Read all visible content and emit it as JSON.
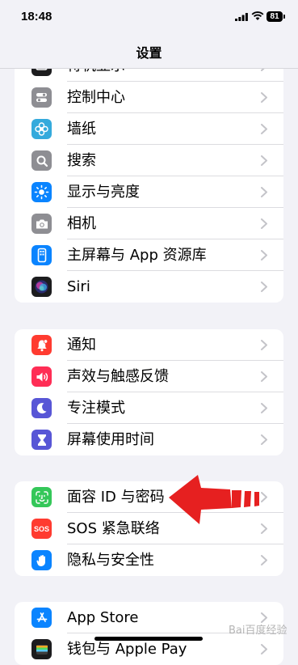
{
  "status_bar": {
    "time": "18:48",
    "battery": "81"
  },
  "nav": {
    "title": "设置"
  },
  "groups": [
    {
      "items": [
        {
          "label": "待机显示",
          "icon": "standby-icon",
          "color": "#1c1c1e"
        },
        {
          "label": "控制中心",
          "icon": "control-center-icon",
          "color": "#8e8e93"
        },
        {
          "label": "墙纸",
          "icon": "wallpaper-flower-icon",
          "color": "#34aadc"
        },
        {
          "label": "搜索",
          "icon": "search-icon",
          "color": "#8e8e93"
        },
        {
          "label": "显示与亮度",
          "icon": "brightness-sun-icon",
          "color": "#0a84ff"
        },
        {
          "label": "相机",
          "icon": "camera-icon",
          "color": "#8e8e93"
        },
        {
          "label": "主屏幕与 App 资源库",
          "icon": "home-screen-icon",
          "color": "#0a84ff"
        },
        {
          "label": "Siri",
          "icon": "siri-icon",
          "color": "#1c1c1e"
        }
      ]
    },
    {
      "items": [
        {
          "label": "通知",
          "icon": "notification-bell-icon",
          "color": "#ff3b30"
        },
        {
          "label": "声效与触感反馈",
          "icon": "speaker-icon",
          "color": "#ff2d55"
        },
        {
          "label": "专注模式",
          "icon": "moon-icon",
          "color": "#5856d6"
        },
        {
          "label": "屏幕使用时间",
          "icon": "hourglass-icon",
          "color": "#5856d6"
        }
      ]
    },
    {
      "items": [
        {
          "label": "面容 ID 与密码",
          "icon": "face-id-icon",
          "color": "#34c759"
        },
        {
          "label": "SOS 紧急联络",
          "icon": "sos-icon",
          "color": "#ff3b30",
          "badge": "SOS"
        },
        {
          "label": "隐私与安全性",
          "icon": "hand-icon",
          "color": "#0a84ff"
        }
      ]
    },
    {
      "items": [
        {
          "label": "App Store",
          "icon": "app-store-icon",
          "color": "#0a84ff"
        },
        {
          "label": "钱包与 Apple Pay",
          "icon": "wallet-icon",
          "color": "#1c1c1e"
        }
      ]
    }
  ],
  "watermark": "Bai百度经验",
  "annotation": {
    "color": "#e62020"
  }
}
